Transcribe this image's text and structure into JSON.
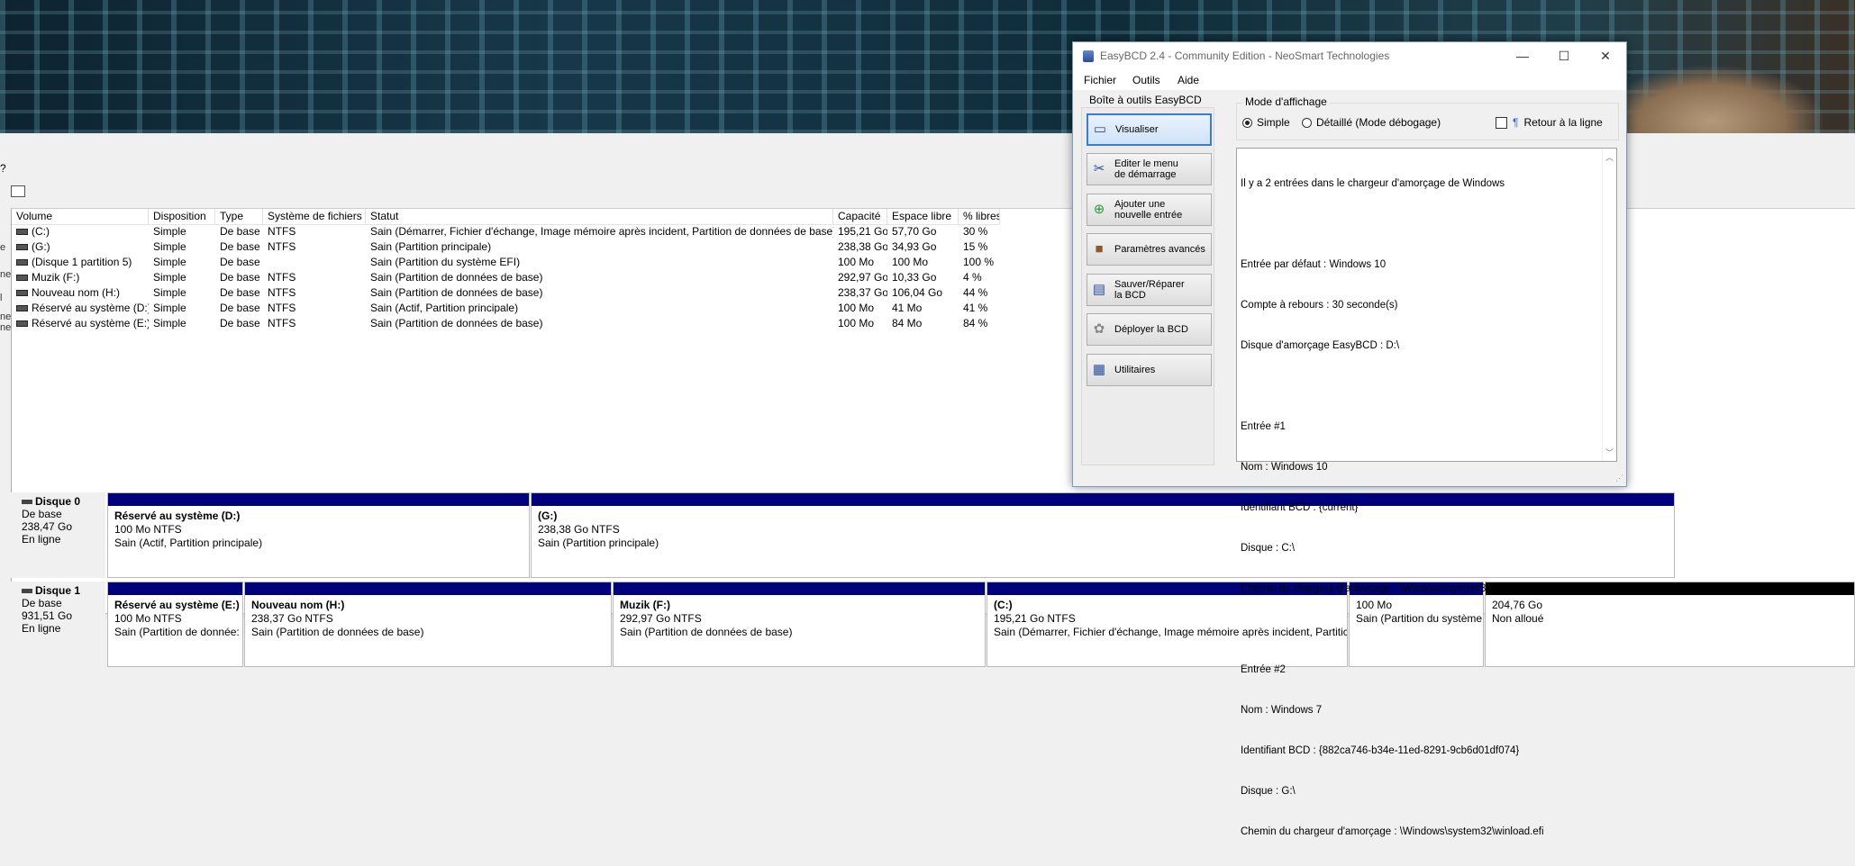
{
  "diskmgmt": {
    "menu_fragment": "?",
    "left_tab_fragments": [
      "e",
      "ne",
      "l",
      "ne",
      "ne"
    ],
    "columns": [
      "Volume",
      "Disposition",
      "Type",
      "Système de fichiers",
      "Statut",
      "Capacité",
      "Espace libre",
      "% libres"
    ],
    "volumes": [
      [
        "(C:)",
        "Simple",
        "De base",
        "NTFS",
        "Sain (Démarrer, Fichier d'échange, Image mémoire après incident, Partition de données de base)",
        "195,21 Go",
        "57,70 Go",
        "30 %"
      ],
      [
        "(G:)",
        "Simple",
        "De base",
        "NTFS",
        "Sain (Partition principale)",
        "238,38 Go",
        "34,93 Go",
        "15 %"
      ],
      [
        "(Disque 1 partition 5)",
        "Simple",
        "De base",
        "",
        "Sain (Partition du système EFI)",
        "100 Mo",
        "100 Mo",
        "100 %"
      ],
      [
        "Muzik  (F:)",
        "Simple",
        "De base",
        "NTFS",
        "Sain (Partition de données de base)",
        "292,97 Go",
        "10,33 Go",
        "4 %"
      ],
      [
        "Nouveau nom (H:)",
        "Simple",
        "De base",
        "NTFS",
        "Sain (Partition de données de base)",
        "238,37 Go",
        "106,04 Go",
        "44 %"
      ],
      [
        "Réservé au système (D:)",
        "Simple",
        "De base",
        "NTFS",
        "Sain (Actif, Partition principale)",
        "100 Mo",
        "41 Mo",
        "41 %"
      ],
      [
        "Réservé au système (E:)",
        "Simple",
        "De base",
        "NTFS",
        "Sain (Partition de données de base)",
        "100 Mo",
        "84 Mo",
        "84 %"
      ]
    ],
    "disks": [
      {
        "name": "Disque 0",
        "type": "De base",
        "size": "238,47 Go",
        "state": "En ligne",
        "partitions": [
          {
            "name": "Réservé au système  (D:)",
            "size": "100 Mo NTFS",
            "status": "Sain (Actif, Partition principale)"
          },
          {
            "name": "(G:)",
            "size": "238,38 Go NTFS",
            "status": "Sain (Partition principale)"
          }
        ]
      },
      {
        "name": "Disque 1",
        "type": "De base",
        "size": "931,51 Go",
        "state": "En ligne",
        "partitions": [
          {
            "name": "Réservé au système  (E:)",
            "size": "100 Mo NTFS",
            "status": "Sain (Partition de donnée:"
          },
          {
            "name": "Nouveau nom  (H:)",
            "size": "238,37 Go NTFS",
            "status": "Sain (Partition de données de base)"
          },
          {
            "name": "Muzik  (F:)",
            "size": "292,97 Go NTFS",
            "status": "Sain (Partition de données de base)"
          },
          {
            "name": "(C:)",
            "size": "195,21 Go NTFS",
            "status": "Sain (Démarrer, Fichier d'échange, Image mémoire après incident, Partitic"
          },
          {
            "name": "",
            "size": "100 Mo",
            "status": "Sain (Partition du système"
          },
          {
            "name": "",
            "size": "204,76 Go",
            "status": "Non alloué"
          }
        ]
      }
    ]
  },
  "easybcd": {
    "title": "EasyBCD 2.4 - Community Edition - NeoSmart Technologies",
    "window_controls": {
      "minimize": "—",
      "maximize": "☐",
      "close": "✕"
    },
    "menu": [
      "Fichier",
      "Outils",
      "Aide"
    ],
    "toolbox_title": "Boîte à outils EasyBCD",
    "toolbox_buttons": [
      {
        "label": "Visualiser",
        "icon": "monitor-icon"
      },
      {
        "label": "Editer le menu\nde démarrage",
        "icon": "tools-icon"
      },
      {
        "label": "Ajouter une\nnouvelle entrée",
        "icon": "add-entry-icon"
      },
      {
        "label": "Paramètres avancés",
        "icon": "advanced-settings-icon"
      },
      {
        "label": "Sauver/Réparer\nla BCD",
        "icon": "save-repair-icon"
      },
      {
        "label": "Déployer la BCD",
        "icon": "deploy-icon"
      },
      {
        "label": "Utilitaires",
        "icon": "utilities-icon"
      }
    ],
    "mode_title": "Mode d'affichage",
    "mode_simple": "Simple",
    "mode_detail": "Détaillé (Mode débogage)",
    "wrap_label": "Retour à la ligne",
    "output_lines": [
      "Il y a 2 entrées dans le chargeur d'amorçage de Windows",
      "",
      "Entrée par défaut : Windows 10",
      "Compte à rebours : 30 seconde(s)",
      "Disque d'amorçage EasyBCD : D:\\",
      "",
      "Entrée #1",
      "Nom : Windows 10",
      "Identifiant BCD : {current}",
      "Disque : C:\\",
      "Chemin du chargeur d'amorçage : \\Windows\\system32\\winload.efi",
      "",
      "Entrée #2",
      "Nom : Windows 7",
      "Identifiant BCD : {882ca746-b34e-11ed-8291-9cb6d01df074}",
      "Disque : G:\\",
      "Chemin du chargeur d'amorçage : \\Windows\\system32\\winload.efi"
    ]
  }
}
